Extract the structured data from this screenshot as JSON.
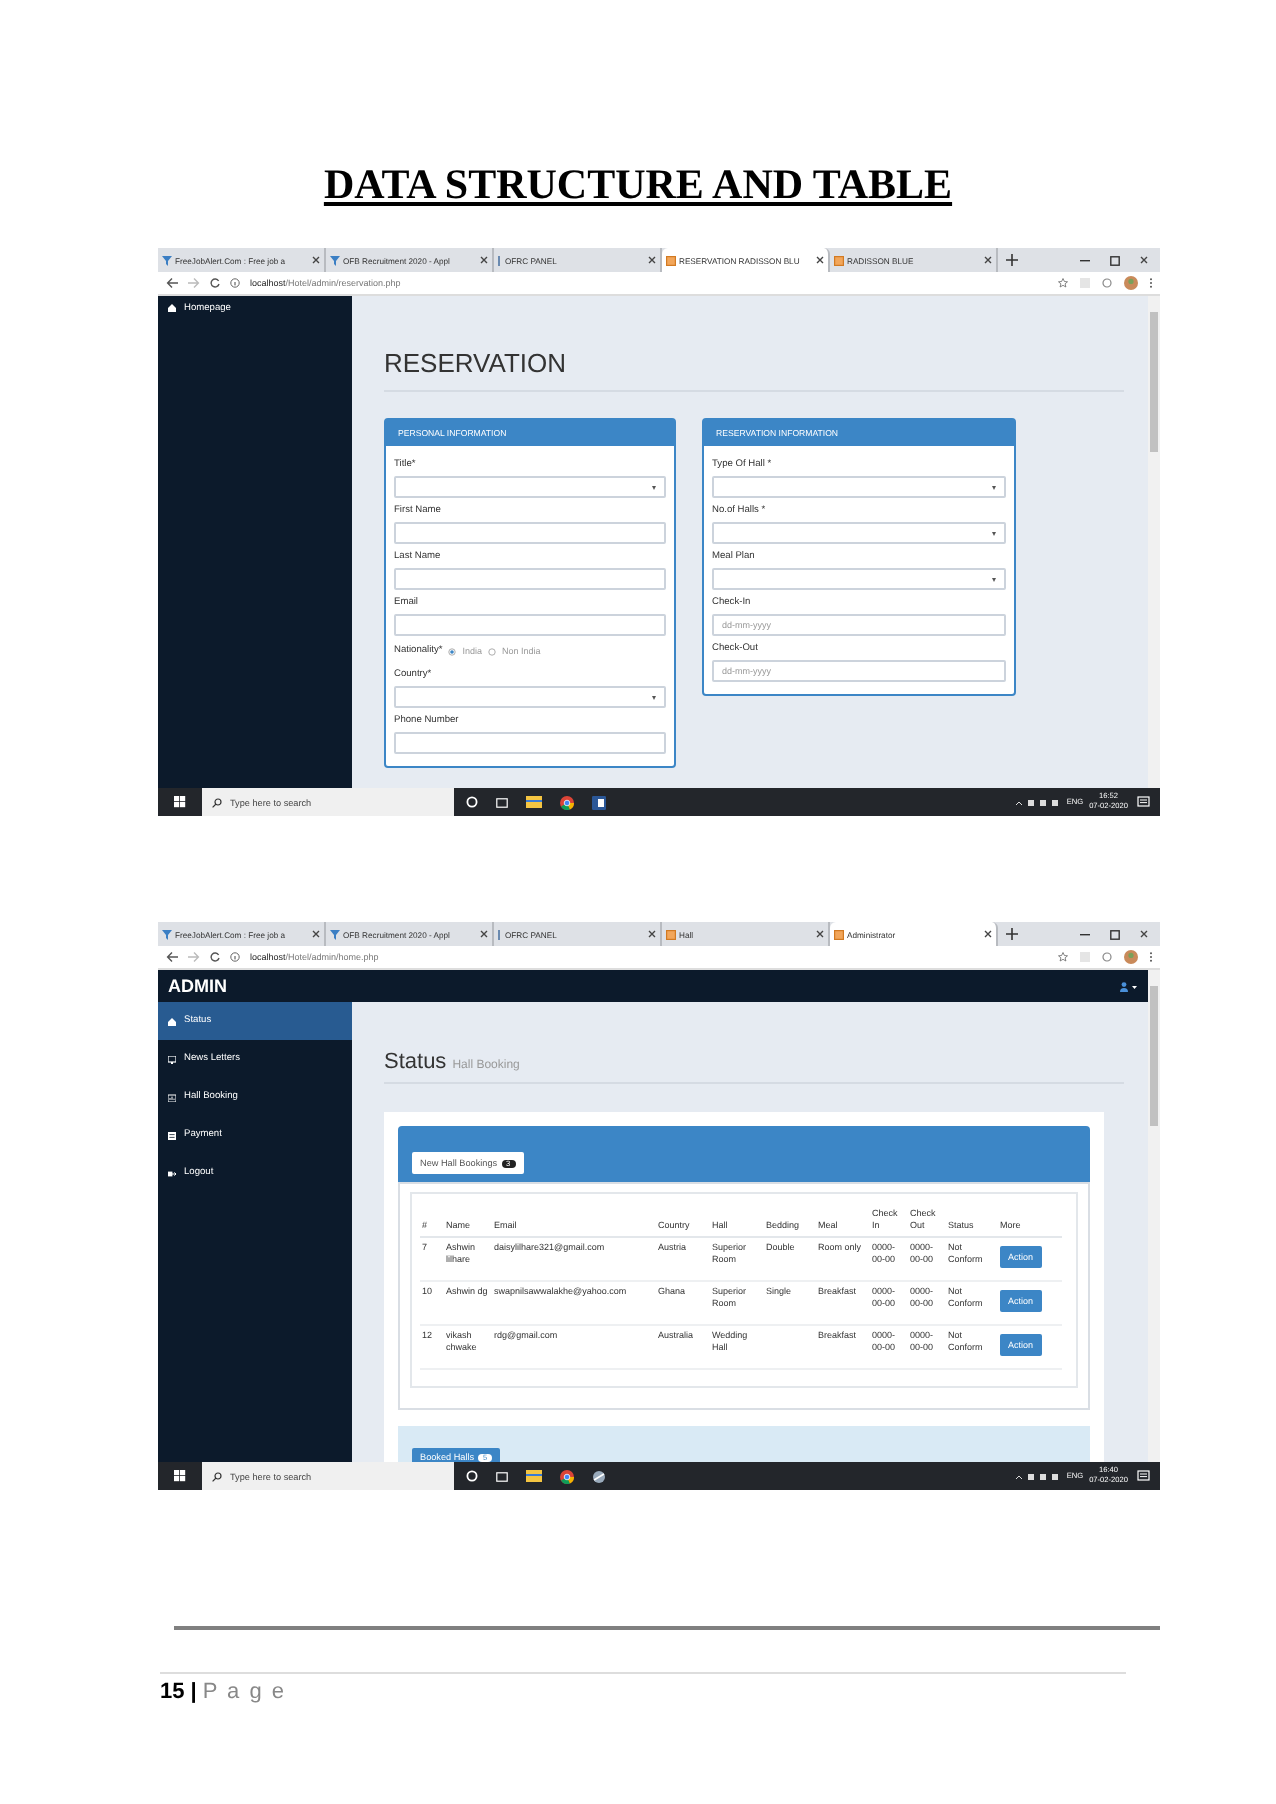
{
  "document": {
    "heading": "DATA STRUCTURE AND TABLE"
  },
  "screenshots": [
    {
      "kind": "reservation",
      "tabs": [
        {
          "title": "FreeJobAlert.Com : Free job a",
          "kind": "jobsite",
          "selected": false
        },
        {
          "title": "OFB Recruitment 2020 - Appl",
          "kind": "jobsite",
          "selected": false
        },
        {
          "title": "OFRC PANEL",
          "kind": "panel",
          "selected": false
        },
        {
          "title": "RESERVATION RADISSON BLU",
          "kind": "hotel",
          "selected": true
        },
        {
          "title": "RADISSON BLUE",
          "kind": "hotel",
          "selected": false
        }
      ],
      "url": {
        "host": "localhost",
        "path": "/Hotel/admin/reservation.php"
      },
      "sidebar": {
        "items": [
          {
            "label": "Homepage",
            "selected": false
          }
        ]
      },
      "page_title": "RESERVATION",
      "panels": [
        {
          "title": "PERSONAL INFORMATION",
          "fields": [
            {
              "label": "Title*",
              "kind": "select"
            },
            {
              "label": "First Name",
              "kind": "text"
            },
            {
              "label": "Last Name",
              "kind": "text"
            },
            {
              "label": "Email",
              "kind": "text"
            },
            {
              "label": "Nationality*",
              "kind": "radio",
              "options": [
                {
                  "label": "India",
                  "selected": true
                },
                {
                  "label": "Non India",
                  "selected": false
                }
              ]
            },
            {
              "label": "Country*",
              "kind": "select"
            },
            {
              "label": "Phone Number",
              "kind": "text"
            }
          ]
        },
        {
          "title": "RESERVATION INFORMATION",
          "fields": [
            {
              "label": "Type Of Hall *",
              "kind": "select"
            },
            {
              "label": "No.of Halls *",
              "kind": "select"
            },
            {
              "label": "Meal Plan",
              "kind": "select"
            },
            {
              "label": "Check-In",
              "kind": "date",
              "placeholder": "dd-mm-yyyy"
            },
            {
              "label": "Check-Out",
              "kind": "date",
              "placeholder": "dd-mm-yyyy"
            }
          ]
        }
      ],
      "taskbar": {
        "search_placeholder": "Type here to search",
        "language": "ENG",
        "time": "16:52",
        "date": "07-02-2020"
      }
    },
    {
      "kind": "admin",
      "tabs": [
        {
          "title": "FreeJobAlert.Com : Free job a",
          "kind": "jobsite",
          "selected": false
        },
        {
          "title": "OFB Recruitment 2020 - Appl",
          "kind": "jobsite",
          "selected": false
        },
        {
          "title": "OFRC PANEL",
          "kind": "panel",
          "selected": false
        },
        {
          "title": "Hall",
          "kind": "hotel",
          "selected": false
        },
        {
          "title": "Administrator",
          "kind": "hotel",
          "selected": true
        }
      ],
      "url": {
        "host": "localhost",
        "path": "/Hotel/admin/home.php"
      },
      "brand": "ADMIN",
      "sidebar": {
        "items": [
          {
            "label": "Status",
            "selected": true
          },
          {
            "label": "News Letters",
            "selected": false
          },
          {
            "label": "Hall Booking",
            "selected": false
          },
          {
            "label": "Payment",
            "selected": false
          },
          {
            "label": "Logout",
            "selected": false
          }
        ]
      },
      "heading": "Status",
      "subheading": "Hall Booking",
      "new_bookings": {
        "title": "New Hall Bookings",
        "count": "3"
      },
      "table": {
        "columns": [
          "#",
          "Name",
          "Email",
          "Country",
          "Hall",
          "Bedding",
          "Meal",
          "Check In",
          "Check Out",
          "Status",
          "More"
        ],
        "rows": [
          {
            "cells": [
              "7",
              "Ashwin lilhare",
              "daisylilhare321@gmail.com",
              "Austria",
              "Superior Room",
              "Double",
              "Room only",
              "0000-00-00",
              "0000-00-00",
              "Not Conform"
            ],
            "action": "Action"
          },
          {
            "cells": [
              "10",
              "Ashwin dg",
              "swapnilsawwalakhe@yahoo.com",
              "Ghana",
              "Superior Room",
              "Single",
              "Breakfast",
              "0000-00-00",
              "0000-00-00",
              "Not Conform"
            ],
            "action": "Action"
          },
          {
            "cells": [
              "12",
              "vikash chwake",
              "rdg@gmail.com",
              "Australia",
              "Wedding Hall",
              null,
              "Breakfast",
              "0000-00-00",
              "0000-00-00",
              "Not Conform"
            ],
            "action": "Action"
          }
        ]
      },
      "booked": {
        "title": "Booked Halls",
        "count": "5"
      },
      "taskbar": {
        "search_placeholder": "Type here to search",
        "language": "ENG",
        "time": "16:40",
        "date": "07-02-2020"
      }
    }
  ],
  "footer": {
    "page_number": "15",
    "separator": "|",
    "page_label": "P a g e"
  }
}
